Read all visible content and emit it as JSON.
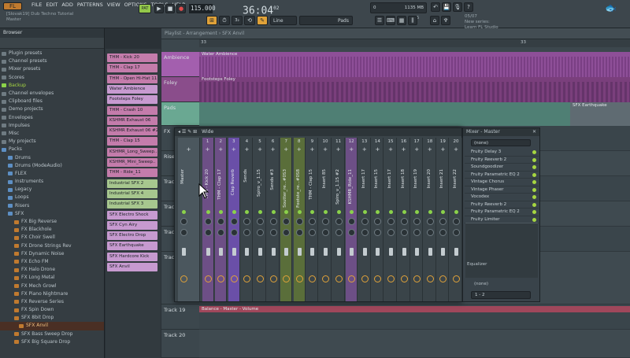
{
  "menu": [
    "FILE",
    "EDIT",
    "ADD",
    "PATTERNS",
    "VIEW",
    "OPTIONS",
    "TOOLS",
    "HELP"
  ],
  "project": {
    "title": "[Slovak19] Dub Techno Tutorial",
    "channel": "Master"
  },
  "transport": {
    "tempo": "115.000",
    "time_main": "36:04",
    "time_sub": "02",
    "pat": "PAT",
    "song": "SONG",
    "snap": "Line",
    "pattern_name": "Pads",
    "cpu_mem": "1135 MB",
    "cpu_val": "26",
    "cpu_zero": "0"
  },
  "hint": {
    "date": "05/07",
    "line1": "New series:",
    "line2": "Learn FL Studio"
  },
  "browser": {
    "title": "Browser",
    "items": [
      {
        "label": "Plugin presets",
        "type": "folder"
      },
      {
        "label": "Channel presets",
        "type": "folder"
      },
      {
        "label": "Mixer presets",
        "type": "folder"
      },
      {
        "label": "Scores",
        "type": "folder"
      },
      {
        "label": "Backup",
        "type": "special"
      },
      {
        "label": "Channel envelopes",
        "type": "folder"
      },
      {
        "label": "Clipboard files",
        "type": "folder"
      },
      {
        "label": "Demo projects",
        "type": "folder"
      },
      {
        "label": "Envelopes",
        "type": "folder"
      },
      {
        "label": "Impulses",
        "type": "folder"
      },
      {
        "label": "Misc",
        "type": "folder"
      },
      {
        "label": "My projects",
        "type": "folder"
      },
      {
        "label": "Packs",
        "type": "pack"
      },
      {
        "label": "Drums",
        "type": "sub"
      },
      {
        "label": "Drums (ModeAudio)",
        "type": "sub"
      },
      {
        "label": "FLEX",
        "type": "sub"
      },
      {
        "label": "Instruments",
        "type": "sub"
      },
      {
        "label": "Legacy",
        "type": "sub"
      },
      {
        "label": "Loops",
        "type": "sub"
      },
      {
        "label": "Risers",
        "type": "sub"
      },
      {
        "label": "SFX",
        "type": "sub"
      },
      {
        "label": "FX Big Reverse",
        "type": "file"
      },
      {
        "label": "FX Blackhole",
        "type": "file"
      },
      {
        "label": "FX Choir Swell",
        "type": "file"
      },
      {
        "label": "FX Drone Strings Rev",
        "type": "file"
      },
      {
        "label": "FX Dynamic Noise",
        "type": "file"
      },
      {
        "label": "FX Echo FM",
        "type": "file"
      },
      {
        "label": "FX Halo Drone",
        "type": "file"
      },
      {
        "label": "FX Long Metal",
        "type": "file"
      },
      {
        "label": "FX Mech Growl",
        "type": "file"
      },
      {
        "label": "FX Piano Nightmare",
        "type": "file"
      },
      {
        "label": "FX Reverse Series",
        "type": "file"
      },
      {
        "label": "FX Spin Down",
        "type": "file"
      },
      {
        "label": "SFX 8bit Drop",
        "type": "file"
      },
      {
        "label": "SFX Anvil",
        "type": "selected"
      },
      {
        "label": "SFX Bass Sweep Drop",
        "type": "file"
      },
      {
        "label": "SFX Big Square Drop",
        "type": "file"
      }
    ]
  },
  "channels": [
    {
      "label": "THM - Kick 20",
      "color": "#c47cab"
    },
    {
      "label": "THM - Clap 17",
      "color": "#c47cab"
    },
    {
      "label": "THM - Open Hi-Hat 11",
      "color": "#c47cab"
    },
    {
      "label": "Water Ambience",
      "color": "#c79ad0"
    },
    {
      "label": "Footsteps Foley",
      "color": "#c79ad0"
    },
    {
      "label": "THM - Crash 10",
      "color": "#c47cab"
    },
    {
      "label": "KSHMR Exhaust 06",
      "color": "#c47cab"
    },
    {
      "label": "KSHMR Exhaust 06 #2",
      "color": "#c47cab"
    },
    {
      "label": "THM - Clap 15",
      "color": "#c47cab"
    },
    {
      "label": "KSHMR_Long_Sweep..",
      "color": "#c47cab"
    },
    {
      "label": "KSHMR_Mini_Sweep..",
      "color": "#c47cab"
    },
    {
      "label": "THM - Ride_11",
      "color": "#c47cab"
    },
    {
      "label": "Industrial SFX 2",
      "color": "#a7c78e"
    },
    {
      "label": "Industrial SFX 4",
      "color": "#a7c78e"
    },
    {
      "label": "Industrial SFX 3",
      "color": "#a7c78e"
    },
    {
      "label": "SFX Electro Shock",
      "color": "#c79ad0"
    },
    {
      "label": "SFX Cyn Airy",
      "color": "#c79ad0"
    },
    {
      "label": "SFX Electro Drop",
      "color": "#c79ad0"
    },
    {
      "label": "SFX Earthquake",
      "color": "#c79ad0"
    },
    {
      "label": "SFX Hardcore Kick",
      "color": "#c79ad0"
    },
    {
      "label": "SFX Anvil",
      "color": "#c79ad0"
    }
  ],
  "playlist": {
    "title": "Playlist - Arrangement › SFX Anvil",
    "bars": [
      "33",
      "",
      "",
      "",
      "",
      "",
      "",
      "",
      "",
      "",
      "",
      "",
      "",
      "",
      "33"
    ],
    "tracks": [
      {
        "label": "Ambience",
        "color": "#a35fae"
      },
      {
        "label": "Foley",
        "color": "#8a4d8b"
      },
      {
        "label": "Pads",
        "color": "#6aa892"
      },
      {
        "label": "FX",
        "color": "#3c474d"
      },
      {
        "label": "Risers",
        "color": "#3c474d"
      },
      {
        "label": "Track",
        "color": "#3c474d"
      },
      {
        "label": "Track",
        "color": "#3c474d"
      },
      {
        "label": "Track",
        "color": "#3c474d"
      },
      {
        "label": "Track",
        "color": "#3c474d"
      },
      {
        "label": "Track 19",
        "color": "#3c474d"
      },
      {
        "label": "Track 20",
        "color": "#3c474d"
      }
    ],
    "clips": {
      "water": "Water Ambience",
      "footsteps": "Footsteps Foley",
      "earthquake": "SFX Earthquake",
      "balance": "Balance - Master - Volume"
    }
  },
  "mixer": {
    "title": "Wide",
    "strips": [
      {
        "num": "",
        "name": "Master",
        "tint": "#4b575e"
      },
      {
        "num": "1",
        "name": "THM - Kick 20",
        "tint": "#6d4f86"
      },
      {
        "num": "2",
        "name": "THM - Clap 17",
        "tint": "#6d4f86"
      },
      {
        "num": "3",
        "name": "Clap Reverb",
        "tint": "#6a4fa8"
      },
      {
        "num": "4",
        "name": "Sends",
        "tint": "#3a4449"
      },
      {
        "num": "5",
        "name": "Spiro_v_1.15",
        "tint": "#3a4449"
      },
      {
        "num": "6",
        "name": "Sends #3",
        "tint": "#3a4449"
      },
      {
        "num": "7",
        "name": "Soutter_re...#0S3",
        "tint": "#5a6e3a"
      },
      {
        "num": "8",
        "name": "Footste_re...#0S8",
        "tint": "#5a6e3a"
      },
      {
        "num": "9",
        "name": "THM - Clap 15",
        "tint": "#3a4449"
      },
      {
        "num": "10",
        "name": "Insert 85",
        "tint": "#3a4449"
      },
      {
        "num": "11",
        "name": "Spiro_v_1.15 #2",
        "tint": "#3a4449"
      },
      {
        "num": "12",
        "name": "KSHMR_Ride_11",
        "tint": "#6d4f86"
      },
      {
        "num": "13",
        "name": "Insert 17",
        "tint": "#3a4449"
      },
      {
        "num": "14",
        "name": "Insert 15",
        "tint": "#3a4449"
      },
      {
        "num": "15",
        "name": "Insert 17",
        "tint": "#3a4449"
      },
      {
        "num": "16",
        "name": "Insert 18",
        "tint": "#3a4449"
      },
      {
        "num": "17",
        "name": "Insert 19",
        "tint": "#3a4449"
      },
      {
        "num": "18",
        "name": "Insert 20",
        "tint": "#3a4449"
      },
      {
        "num": "19",
        "name": "Insert 21",
        "tint": "#3a4449"
      },
      {
        "num": "20",
        "name": "Insert 22",
        "tint": "#3a4449"
      }
    ]
  },
  "mixer_master": {
    "title": "Mixer - Master",
    "input": "(none)",
    "slots": [
      "Fruity Delay 3",
      "Fruity Reeverb 2",
      "Soundgoodizer",
      "Fruity Parametric EQ 2",
      "Vintage Chorus",
      "Vintage Phaser",
      "Vocodex",
      "Fruity Reeverb 2",
      "Fruity Parametric EQ 2",
      "Fruity Limiter"
    ],
    "eq_label": "Equalizer",
    "output": "(none)",
    "route": "1 - 2"
  }
}
